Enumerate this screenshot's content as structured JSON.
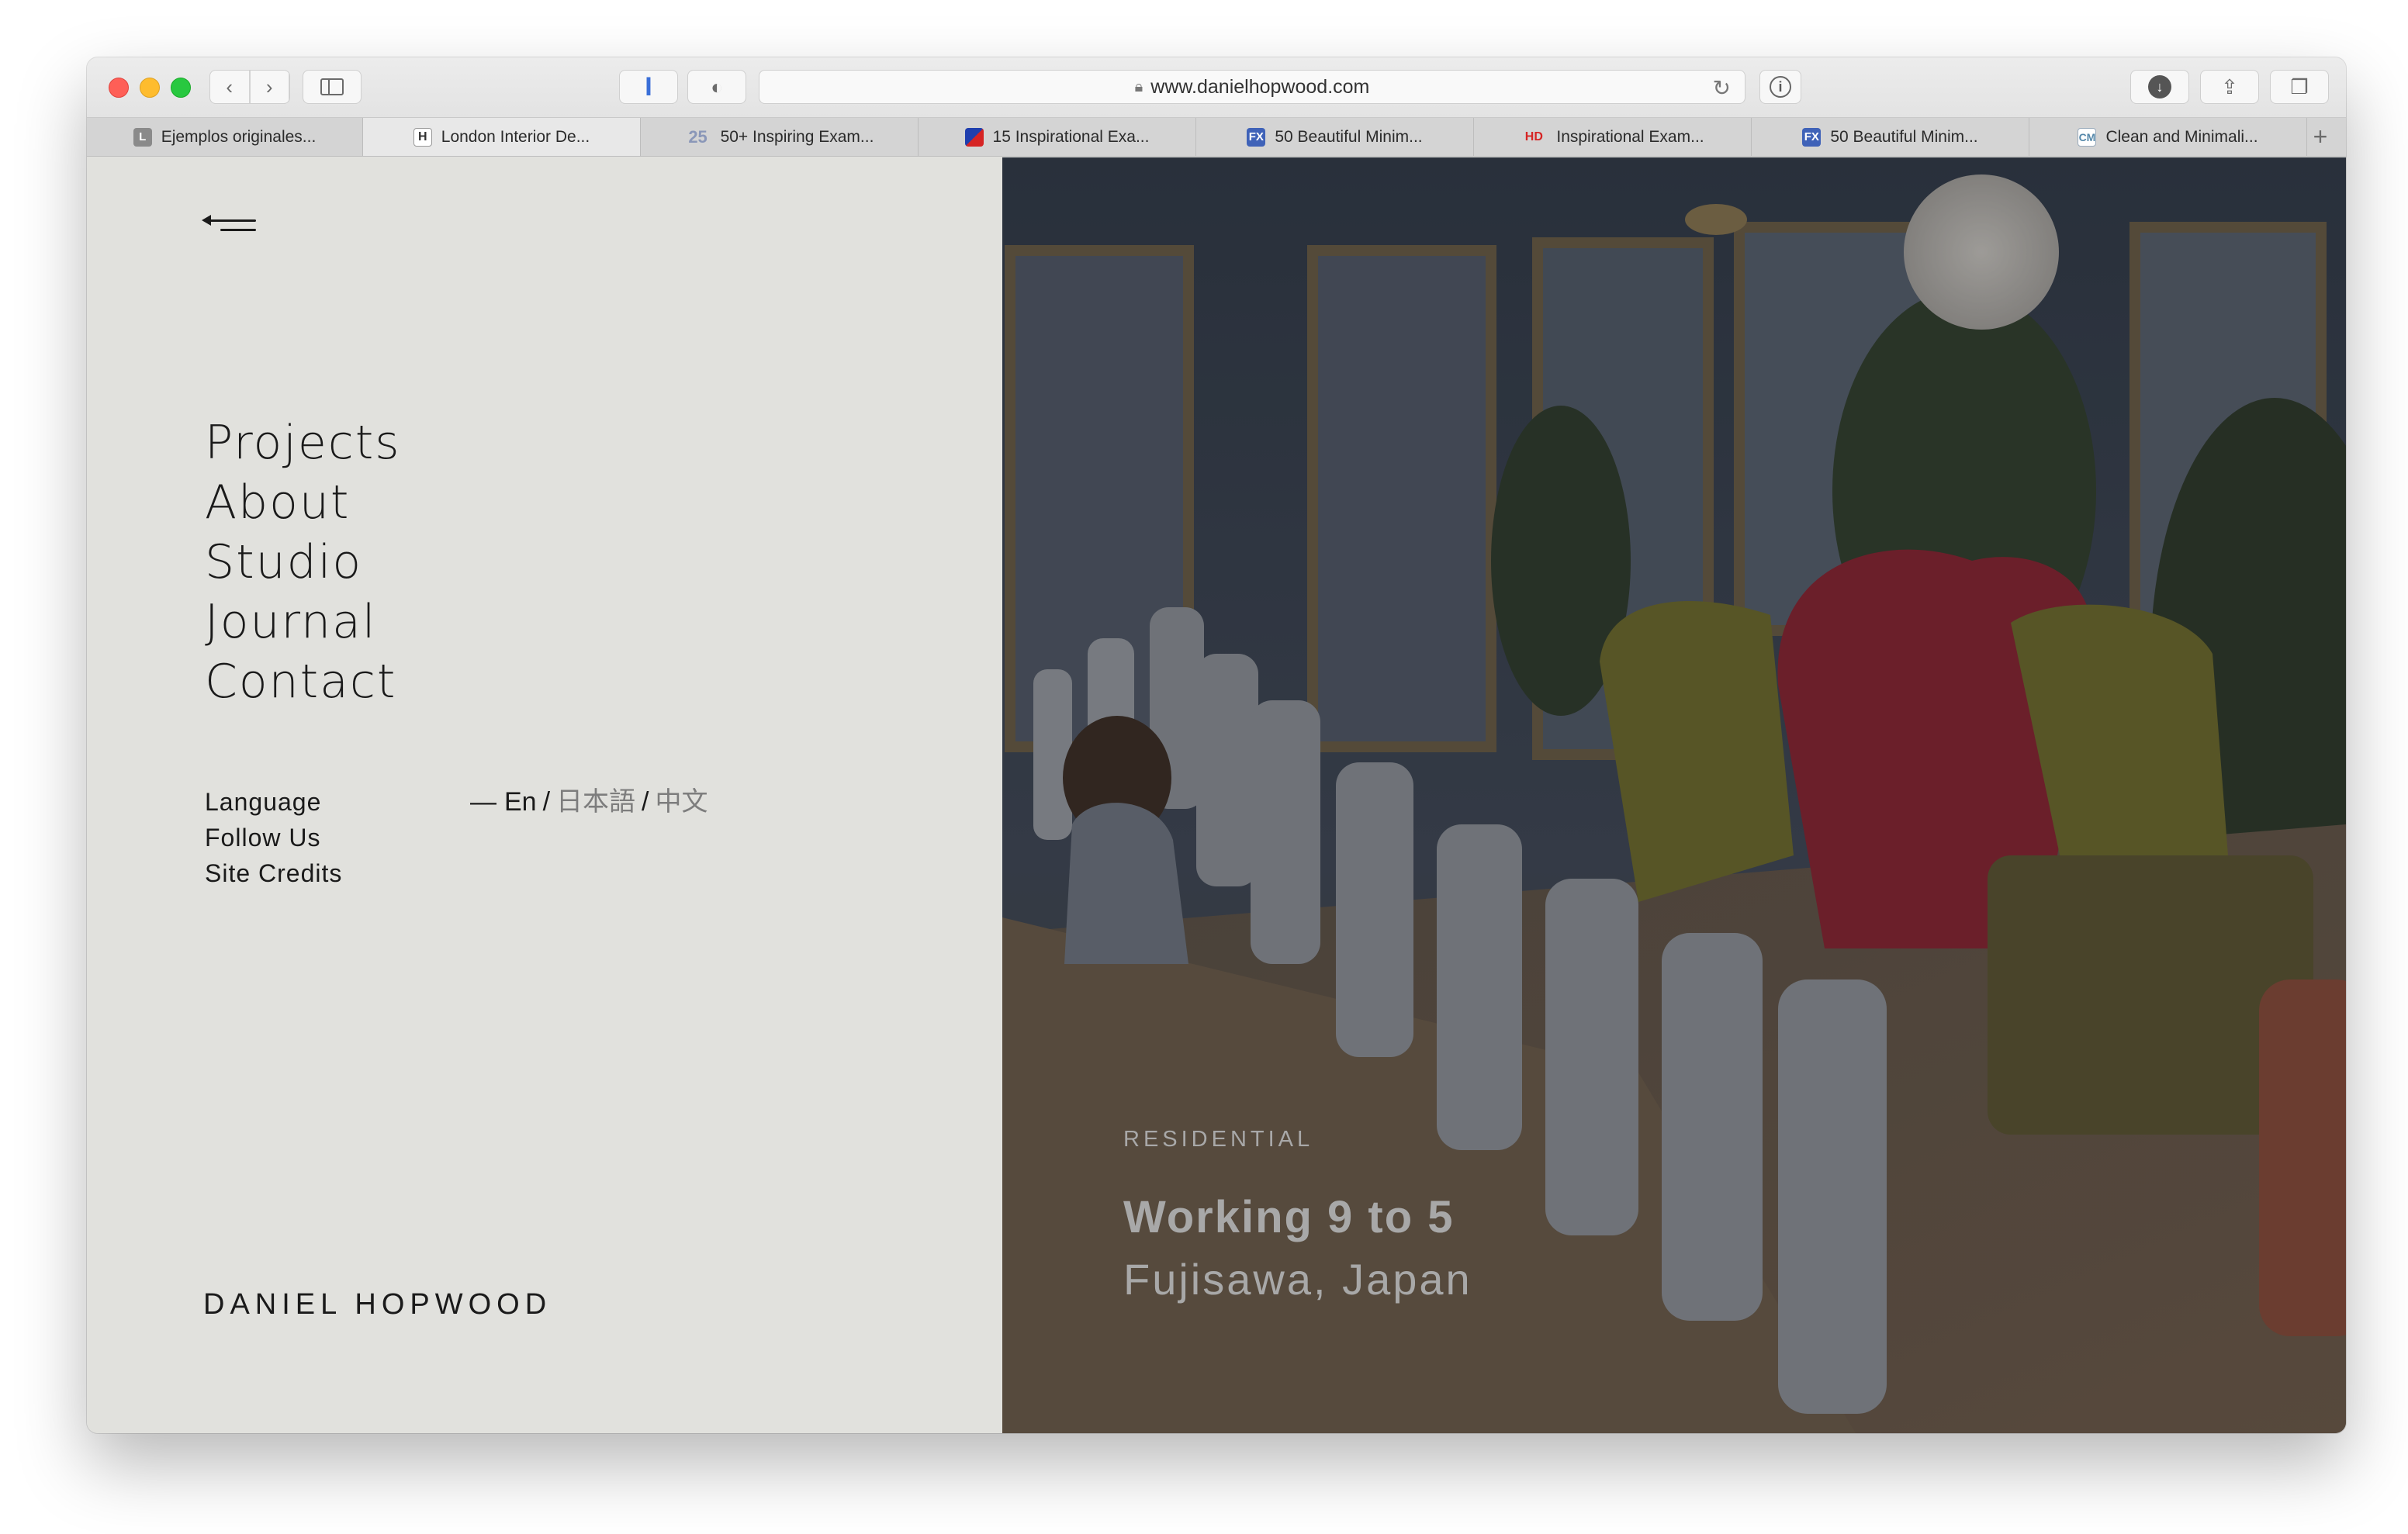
{
  "browser": {
    "url": "www.danielhopwood.com",
    "tabs": [
      {
        "label": "Ejemplos originales...",
        "favicon": "L"
      },
      {
        "label": "London Interior De...",
        "favicon": "H"
      },
      {
        "label": "50+ Inspiring Exam...",
        "favicon": "25"
      },
      {
        "label": "15 Inspirational Exa...",
        "favicon": ""
      },
      {
        "label": "50 Beautiful Minim...",
        "favicon": "FX"
      },
      {
        "label": "Inspirational Exam...",
        "favicon": "HD"
      },
      {
        "label": "50 Beautiful Minim...",
        "favicon": "FX"
      },
      {
        "label": "Clean and Minimali...",
        "favicon": "CM"
      }
    ],
    "new_tab_glyph": "+",
    "active_tab_index": 1
  },
  "nav": {
    "items": [
      "Projects",
      "About",
      "Studio",
      "Journal",
      "Contact"
    ]
  },
  "meta": {
    "language_label": "Language",
    "follow_label": "Follow Us",
    "credits_label": "Site Credits"
  },
  "languages": {
    "dash": "—",
    "current": "En",
    "separator": "/",
    "japanese": "日本語",
    "chinese": "中文"
  },
  "brand": "DANIEL HOPWOOD",
  "hero": {
    "category": "RESIDENTIAL",
    "title": "Working 9 to 5",
    "location": "Fujisawa, Japan"
  },
  "icons": {
    "back": "chevron-left-icon",
    "forward": "chevron-right-icon",
    "sidebar": "sidebar-icon",
    "reload": "reload-icon",
    "info": "info-icon",
    "download": "download-icon",
    "share": "share-icon",
    "tabs": "tab-overview-icon",
    "lock": "lock-icon",
    "menu": "menu-collapse-icon"
  },
  "colors": {
    "panel_bg": "#e1e1dd",
    "text": "#1a1a1a",
    "caption": "#a8a8a8",
    "chair_red": "#a8293a",
    "chair_olive": "#8c8a34"
  }
}
